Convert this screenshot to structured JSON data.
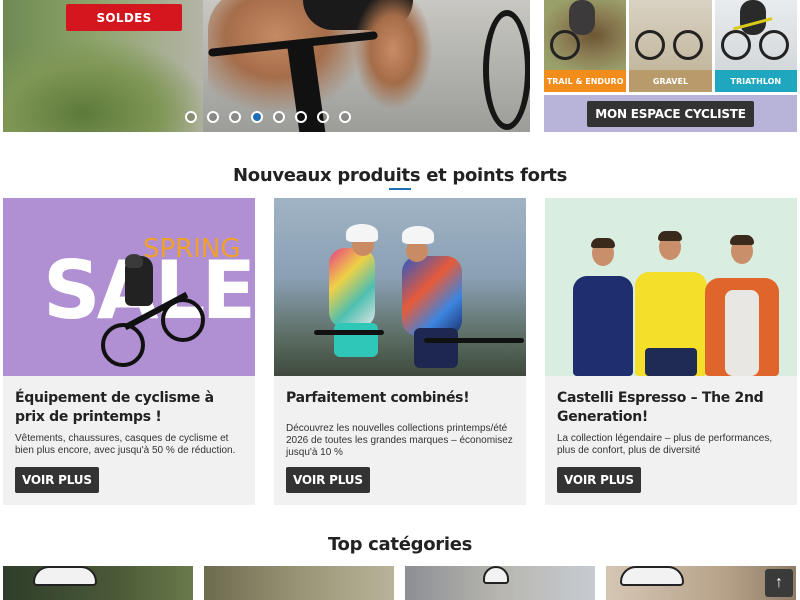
{
  "hero": {
    "badge_label": "SOLDES",
    "slide_count": 8,
    "active_slide_index": 3
  },
  "tiles": [
    {
      "label": "TRAIL & ENDURO",
      "color": "#f28c1a"
    },
    {
      "label": "GRAVEL",
      "color": "#b99a6a"
    },
    {
      "label": "TRIATHLON",
      "color": "#1fa7bf"
    }
  ],
  "espace": {
    "label": "MON ESPACE CYCLISTE"
  },
  "new_section": {
    "title": "Nouveaux produits et points forts"
  },
  "cards": [
    {
      "image_text_spring": "SPRING",
      "image_text_sale": "SALE",
      "title": "Équipement de cyclisme à prix de printemps !",
      "description": "Vêtements, chaussures, casques de cyclisme et bien plus encore, avec jusqu'à 50 % de réduction.",
      "button": "VOIR PLUS"
    },
    {
      "title": "Parfaitement combinés!",
      "description": "Découvrez les nouvelles collections printemps/été 2026 de toutes les grandes marques – économisez jusqu'à 10 %",
      "button": "VOIR PLUS"
    },
    {
      "title": "Castelli Espresso – The 2nd Generation!",
      "description": "La collection légendaire – plus de performances, plus de confort, plus de diversité",
      "button": "VOIR PLUS"
    }
  ],
  "top_categories": {
    "title": "Top catégories"
  },
  "back_to_top": {
    "icon": "arrow-up-icon",
    "glyph": "↑"
  },
  "colors": {
    "accent": "#1e6fb5",
    "sale_red": "#d4171f",
    "button_dark": "#333333",
    "espace_bg": "#b8b4d9"
  }
}
